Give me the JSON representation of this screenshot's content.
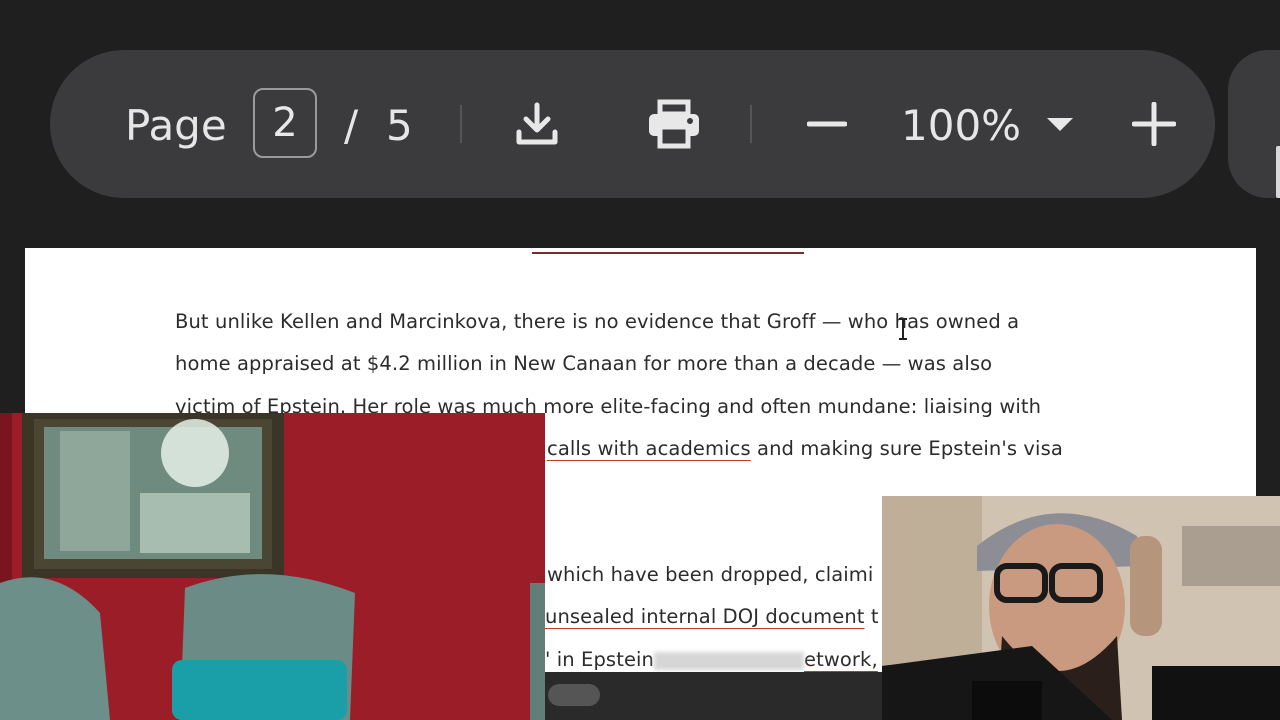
{
  "toolbar": {
    "page_label": "Page",
    "current_page": "2",
    "separator": "/",
    "total_pages": "5",
    "zoom": "100%",
    "icons": [
      "download-icon",
      "print-icon",
      "zoom-out-icon",
      "zoom-dropdown-icon",
      "zoom-in-icon"
    ]
  },
  "document": {
    "lines": [
      {
        "before": "But unlike Kellen and Marcinkova, there is no evidence that Groff — who has owned a",
        "link": "",
        "after": ""
      },
      {
        "before": "home appraised at $4.2 million in New Canaan for more than a decade — was also",
        "link": "",
        "after": ""
      },
      {
        "before": "victim of Epstein. Her role was much more elite-facing and often mundane: liaising with",
        "link": "",
        "after": ""
      },
      {
        "before": "",
        "link": "calls with academics",
        "after": " and making sure Epstein's visa"
      },
      {
        "before": "which have been dropped,  claimi",
        "link": "",
        "after": ""
      },
      {
        "before": "",
        "link": "unsealed internal DOJ document",
        "after": " t"
      },
      {
        "before": "' in Epstein",
        "link": "",
        "after": "etwork,"
      }
    ]
  },
  "colors": {
    "background": "#1f1f1f",
    "toolbar": "#3b3b3d",
    "page": "#ffffff",
    "link_underline": "#c0392b"
  }
}
